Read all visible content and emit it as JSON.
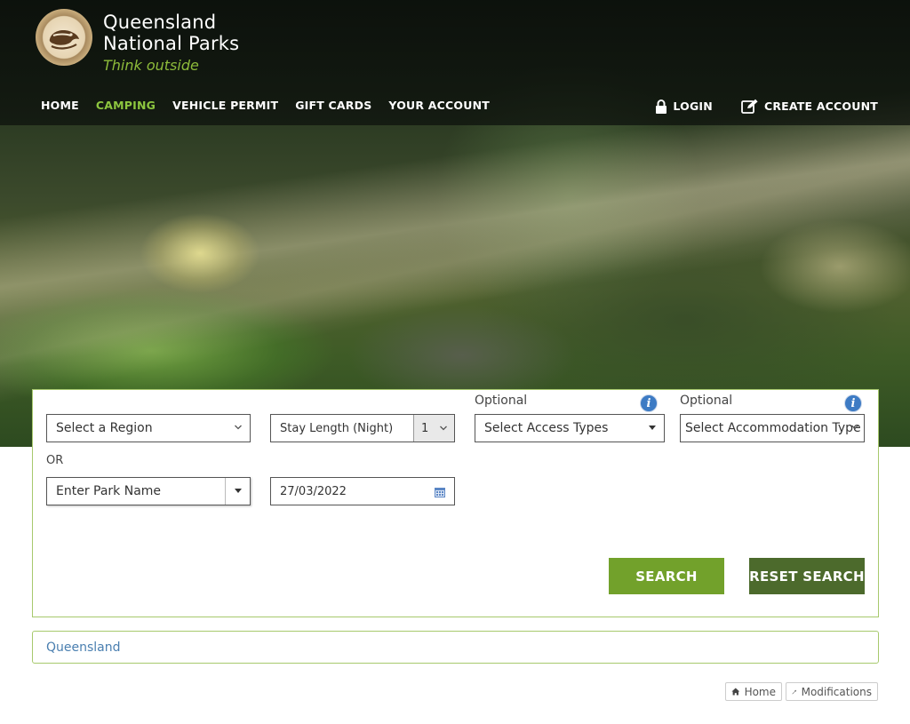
{
  "brand": {
    "name_line1": "Queensland",
    "name_line2": "National Parks",
    "tagline": "Think outside"
  },
  "nav": {
    "items": [
      {
        "label": "HOME",
        "active": false
      },
      {
        "label": "CAMPING",
        "active": true
      },
      {
        "label": "VEHICLE PERMIT",
        "active": false
      },
      {
        "label": "GIFT CARDS",
        "active": false
      },
      {
        "label": "YOUR ACCOUNT",
        "active": false
      }
    ],
    "login_label": "LOGIN",
    "create_account_label": "CREATE ACCOUNT"
  },
  "search": {
    "region_select": "Select a Region",
    "stay_length_label": "Stay Length (Night)",
    "stay_length_value": "1",
    "access_optional_label": "Optional",
    "access_select": "Select Access Types",
    "accommodation_optional_label": "Optional",
    "accommodation_select": "Select Accommodation Type",
    "or_label": "OR",
    "park_name_placeholder": "Enter Park Name",
    "date_value": "27/03/2022",
    "search_button": "SEARCH",
    "reset_button": "RESET SEARCH"
  },
  "breadcrumb": {
    "location": "Queensland"
  },
  "footer": {
    "home_label": "Home",
    "modifications_label": "Modifications"
  },
  "colors": {
    "accent_green": "#72a12b",
    "dark_green": "#4c6a2c",
    "active_nav": "#8dc63f",
    "info_blue": "#3d7bc4",
    "link_blue": "#4a7fb0"
  }
}
